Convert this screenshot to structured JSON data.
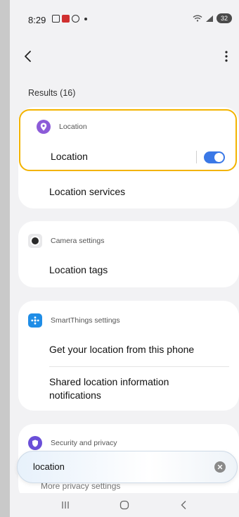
{
  "status_bar": {
    "time": "8:29",
    "battery": "32"
  },
  "header": {
    "results_label": "Results (16)"
  },
  "groups": [
    {
      "category": "Location",
      "items": [
        {
          "label": "Location",
          "toggle_on": true
        },
        {
          "label": "Location services"
        }
      ]
    },
    {
      "category": "Camera settings",
      "items": [
        {
          "label": "Location tags"
        }
      ]
    },
    {
      "category": "SmartThings settings",
      "items": [
        {
          "label": "Get your location from this phone"
        },
        {
          "label": "Shared location information notifications"
        }
      ]
    },
    {
      "category": "Security and privacy",
      "items": [
        {
          "label": "More privacy settings"
        }
      ]
    }
  ],
  "search": {
    "query": "location"
  },
  "colors": {
    "accent": "#3a78e6",
    "highlight": "#f3b300",
    "location_icon": "#8c5bd8",
    "smartthings_icon": "#1f8de6",
    "security_icon": "#6a4fd8"
  },
  "icons": {
    "back": "chevron-left-icon",
    "more": "more-vertical-icon",
    "location": "location-pin-icon",
    "camera": "camera-icon",
    "smartthings": "smartthings-icon",
    "security": "shield-icon",
    "clear": "clear-icon"
  }
}
